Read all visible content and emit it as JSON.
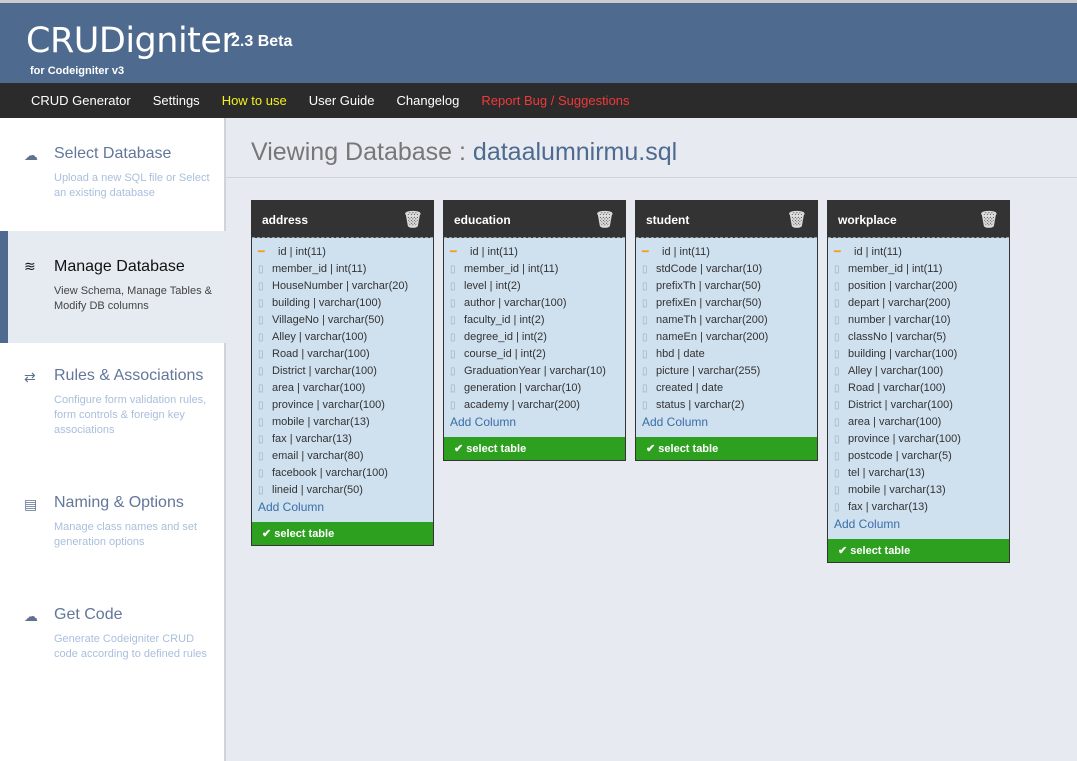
{
  "header": {
    "brand": "CRUDigniter",
    "version": "2.3 Beta",
    "subtitle": "for Codeigniter v3"
  },
  "nav": [
    {
      "label": "CRUD Generator",
      "color": "#ffffff"
    },
    {
      "label": "Settings",
      "color": "#ffffff"
    },
    {
      "label": "How to use",
      "color": "#f2f21c"
    },
    {
      "label": "User Guide",
      "color": "#ffffff"
    },
    {
      "label": "Changelog",
      "color": "#ffffff"
    },
    {
      "label": "Report Bug / Suggestions",
      "color": "#f0393a"
    }
  ],
  "sidebar": [
    {
      "icon": "cloud-upload-icon",
      "title": "Select Database",
      "desc": "Upload a new SQL file or Select an existing database"
    },
    {
      "icon": "database-icon",
      "title": "Manage Database",
      "desc": "View Schema, Manage Tables & Modify DB columns",
      "active": true
    },
    {
      "icon": "exchange-icon",
      "title": "Rules & Associations",
      "desc": "Configure form validation rules, form controls & foreign key associations"
    },
    {
      "icon": "file-icon",
      "title": "Naming & Options",
      "desc": "Manage class names and set generation options"
    },
    {
      "icon": "cloud-download-icon",
      "title": "Get Code",
      "desc": "Generate Codeigniter CRUD code according to defined rules"
    }
  ],
  "main": {
    "title_prefix": "Viewing Database :",
    "db_name": "dataalumnirmu.sql",
    "add_column": "Add Column",
    "select_table": "select table",
    "tables": [
      {
        "name": "address",
        "columns": [
          "id | int(11)",
          "member_id | int(11)",
          "HouseNumber | varchar(20)",
          "building | varchar(100)",
          "VillageNo | varchar(50)",
          "Alley | varchar(100)",
          "Road | varchar(100)",
          "District | varchar(100)",
          "area | varchar(100)",
          "province | varchar(100)",
          "mobile | varchar(13)",
          "fax | varchar(13)",
          "email | varchar(80)",
          "facebook | varchar(100)",
          "lineid | varchar(50)"
        ]
      },
      {
        "name": "education",
        "columns": [
          "id | int(11)",
          "member_id | int(11)",
          "level | int(2)",
          "author | varchar(100)",
          "faculty_id | int(2)",
          "degree_id | int(2)",
          "course_id | int(2)",
          "GraduationYear | varchar(10)",
          "generation | varchar(10)",
          "academy | varchar(200)"
        ]
      },
      {
        "name": "student",
        "columns": [
          "id | int(11)",
          "stdCode | varchar(10)",
          "prefixTh | varchar(50)",
          "prefixEn | varchar(50)",
          "nameTh | varchar(200)",
          "nameEn | varchar(200)",
          "hbd | date",
          "picture | varchar(255)",
          "created | date",
          "status | varchar(2)"
        ]
      },
      {
        "name": "workplace",
        "columns": [
          "id | int(11)",
          "member_id | int(11)",
          "position | varchar(200)",
          "depart | varchar(200)",
          "number | varchar(10)",
          "classNo | varchar(5)",
          "building | varchar(100)",
          "Alley | varchar(100)",
          "Road | varchar(100)",
          "District | varchar(100)",
          "area | varchar(100)",
          "province | varchar(100)",
          "postcode | varchar(5)",
          "tel | varchar(13)",
          "mobile | varchar(13)",
          "fax | varchar(13)"
        ]
      }
    ]
  }
}
